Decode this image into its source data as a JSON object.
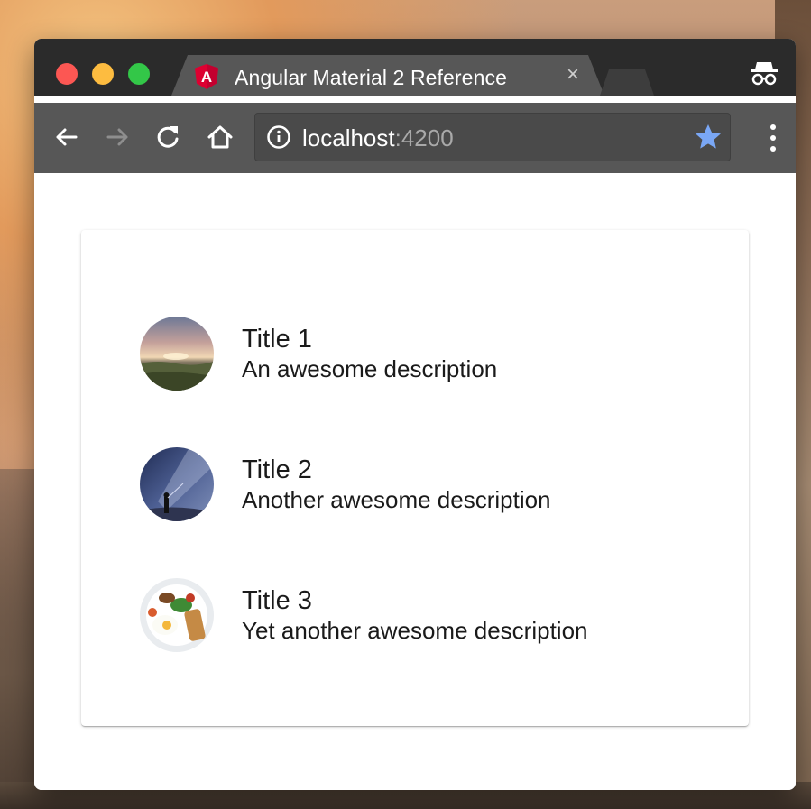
{
  "browser": {
    "tab": {
      "title": "Angular Material 2 Reference",
      "close_glyph": "×",
      "favicon_letter": "A"
    },
    "address_bar": {
      "host": "localhost",
      "port": ":4200"
    },
    "colors": {
      "titlebar": "#2b2b2b",
      "toolbar": "#575757",
      "bookmark_star": "#7aa7f5",
      "angular_red": "#dd0031"
    }
  },
  "list": {
    "items": [
      {
        "title": "Title 1",
        "description": "An awesome description",
        "avatar": "landscape-photo"
      },
      {
        "title": "Title 2",
        "description": "Another awesome description",
        "avatar": "night-sky-photo"
      },
      {
        "title": "Title 3",
        "description": "Yet another awesome description",
        "avatar": "breakfast-plate-photo"
      }
    ]
  }
}
